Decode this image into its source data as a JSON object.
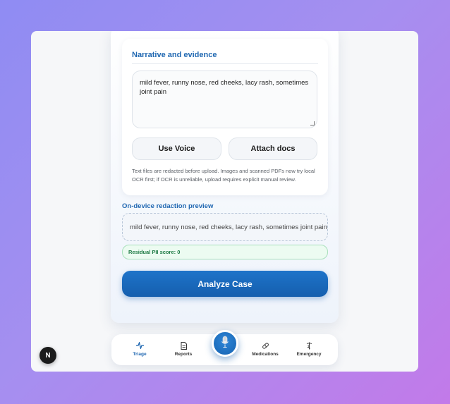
{
  "card": {
    "title": "Narrative and evidence",
    "narrative_value": "mild fever, runny nose, red cheeks, lacy rash, sometimes joint pain",
    "voice_label": "Use Voice",
    "attach_label": "Attach docs",
    "help_text": "Text files are redacted before upload. Images and scanned PDFs now try local OCR first; if OCR is unreliable, upload requires explicit manual review."
  },
  "preview": {
    "label": "On-device redaction preview",
    "text": "mild fever, runny nose, red cheeks, lacy rash, sometimes joint pain",
    "pii_score": "Residual PII score: 0"
  },
  "analyze_label": "Analyze Case",
  "nav": {
    "items": [
      {
        "label": "Triage",
        "icon": "pulse-icon",
        "active": true
      },
      {
        "label": "Reports",
        "icon": "document-icon",
        "active": false
      },
      {
        "label": "Medications",
        "icon": "pill-icon",
        "active": false
      },
      {
        "label": "Emergency",
        "icon": "caduceus-icon",
        "active": false
      }
    ],
    "center_icon": "microphone-icon"
  },
  "next_badge": "N",
  "colors": {
    "accent": "#1f67b1",
    "primary_button": "#1a6bbf",
    "success_bg": "#ecfbf1",
    "success_text": "#1d7a44",
    "background_start": "#8f8cf3",
    "background_end": "#c27ae9"
  }
}
